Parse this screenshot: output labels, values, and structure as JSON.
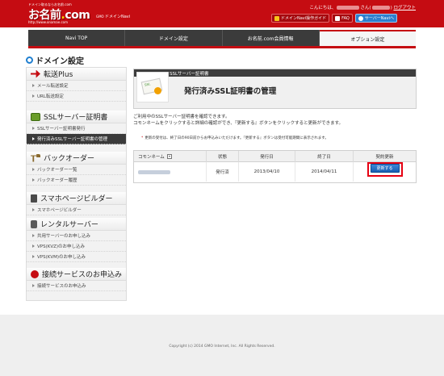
{
  "header": {
    "logo_tagline": "ドメイン取るならお名前.com",
    "logo_brand_main": "お名前",
    "logo_brand_dot": ".",
    "logo_brand_tld": "com",
    "logo_url": "http://www.onamae.com",
    "logo_company": "GMO",
    "service_name": "ドメインNavi",
    "greeting_prefix": "こんにちは、",
    "greeting_san": "さん(",
    "greeting_close": ")",
    "logout": "ログアウト",
    "links": [
      {
        "label": "ドメインNavi操作ガイド",
        "icon": "guide-icon"
      },
      {
        "label": "FAQ",
        "icon": "faq-icon"
      },
      {
        "label": "サーバーNaviへ",
        "icon": "twitter-bird-icon"
      }
    ]
  },
  "nav": {
    "tabs": [
      {
        "label": "Navi TOP",
        "active": false
      },
      {
        "label": "ドメイン設定",
        "active": false
      },
      {
        "label": "お名前.com会員情報",
        "active": false
      },
      {
        "label": "オプション設定",
        "active": true
      }
    ]
  },
  "page_title": "ドメイン設定",
  "sidebar": {
    "sections": [
      {
        "title": "転送Plus",
        "icon": "arrow-icon",
        "items": [
          "メール転送設定",
          "URL転送設定"
        ]
      },
      {
        "title": "SSLサーバー証明書",
        "icon": "certificate-icon",
        "items": [
          "SSLサーバー証明書発行",
          "発行済みSSLサーバー証明書の管理"
        ]
      },
      {
        "title": "バックオーダー",
        "icon": "gavel-icon",
        "items": [
          "バックオーダー一覧",
          "バックオーダー履歴"
        ]
      },
      {
        "title": "スマホページビルダー",
        "icon": "smartphone-icon",
        "items": [
          "スマホページビルダー"
        ]
      },
      {
        "title": "レンタルサーバー",
        "icon": "server-icon",
        "items": [
          "共用サーバーのお申し込み",
          "VPS(KVZ)のお申し込み",
          "VPS(KVM)のお申し込み"
        ]
      },
      {
        "title": "接続サービスのお申込み",
        "icon": "connection-icon",
        "items": [
          "接続サービスのお申込み"
        ]
      }
    ]
  },
  "ssl_panel": {
    "bar_label": "SSLサーバー証明書",
    "heading": "発行済みSSL証明書の管理",
    "graphic_label": "SSL"
  },
  "description": {
    "line1": "ご利用中のSSLサーバー証明書を確認できます。",
    "line2": "コモンネームをクリックすると詳細の確認ができ、『更新する』ボタンをクリックすると更新ができます。",
    "note": "更新の受付は、終了日の90日前からお申込みいただけます。『更新する』ボタンは受付可能期間に表示されます。"
  },
  "table": {
    "headers": {
      "common_name": "コモンネーム",
      "status": "状態",
      "issue_date": "発行日",
      "end_date": "終了日",
      "renewal": "契約更新"
    },
    "row": {
      "status": "発行済",
      "issue_date": "2013/04/10",
      "end_date": "2014/04/11",
      "renew_button": "更新する"
    }
  },
  "footer": {
    "copyright": "Copyright (c) 2014 GMO Internet, Inc. All Rights Reserved."
  },
  "colors": {
    "brand_red": "#c50c12",
    "nav_dark": "#3b3b3b",
    "accent_blue": "#1f7fd0",
    "highlight_red": "#e60012"
  }
}
